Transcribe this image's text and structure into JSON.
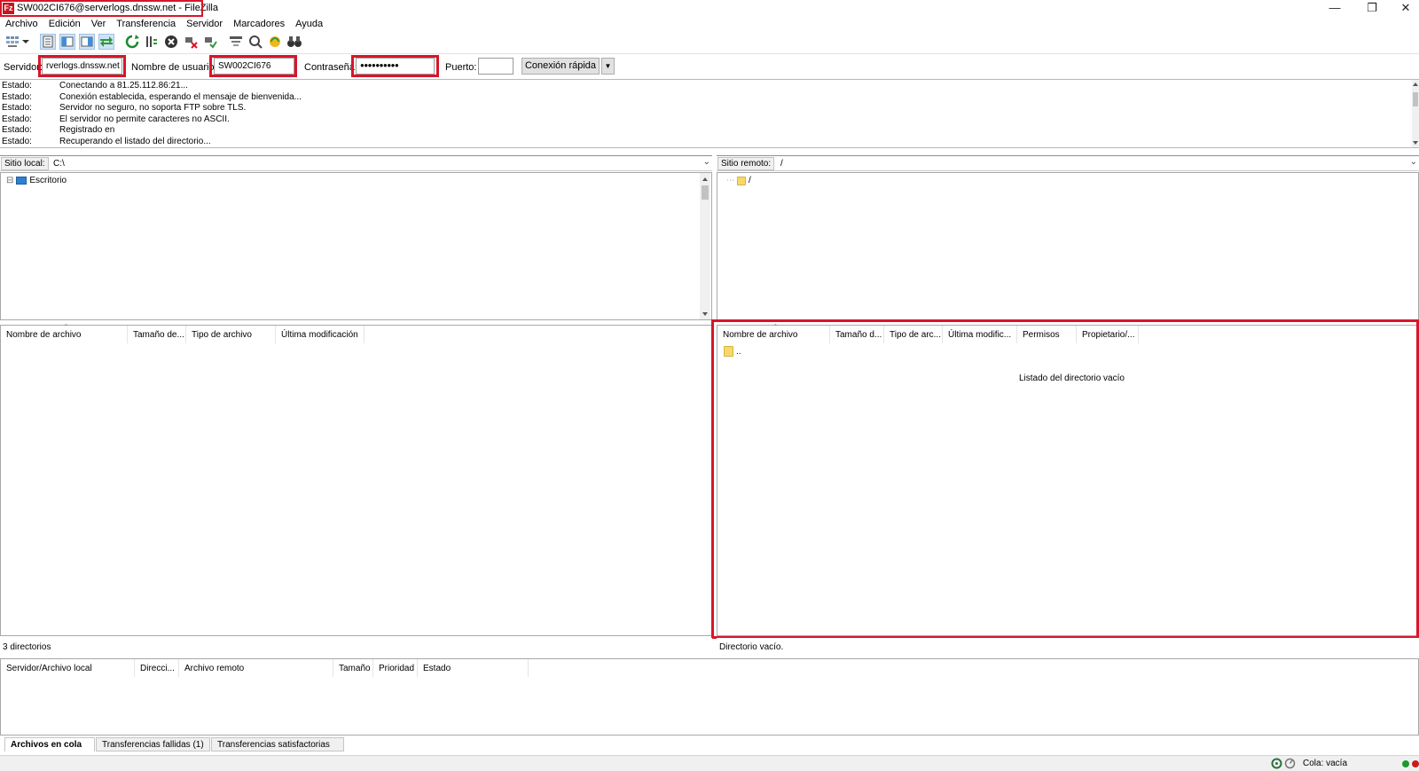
{
  "window": {
    "title": "SW002CI676@serverlogs.dnssw.net - FileZilla",
    "app_icon": "Fz",
    "controls": [
      "—",
      "❐",
      "✕"
    ]
  },
  "menu": [
    "Archivo",
    "Edición",
    "Ver",
    "Transferencia",
    "Servidor",
    "Marcadores",
    "Ayuda"
  ],
  "toolbar": {
    "icons": [
      "site-manager-icon",
      "dropdown-arrow-icon",
      "toggle-log-icon",
      "toggle-local-tree-icon",
      "toggle-remote-tree-icon",
      "toggle-queue-icon",
      "refresh-icon",
      "process-queue-icon",
      "cancel-icon",
      "disconnect-icon",
      "reconnect-icon",
      "filter-icon",
      "search-remote-icon",
      "compare-icon",
      "find-binoculars-icon"
    ]
  },
  "quickconnect": {
    "server_label": "Servidor:",
    "server_value": "rverlogs.dnssw.net",
    "user_label": "Nombre de usuario:",
    "user_value": "SW002CI676",
    "password_label": "Contraseña:",
    "password_value": "●●●●●●●●●●",
    "port_label": "Puerto:",
    "port_value": "",
    "connect_button": "Conexión rápida",
    "dropdown_glyph": "▼"
  },
  "log": [
    {
      "label": "Estado:",
      "message": "Conectando a 81.25.112.86:21..."
    },
    {
      "label": "Estado:",
      "message": "Conexión establecida, esperando el mensaje de bienvenida..."
    },
    {
      "label": "Estado:",
      "message": "Servidor no seguro, no soporta FTP sobre TLS."
    },
    {
      "label": "Estado:",
      "message": "El servidor no permite caracteres no ASCII."
    },
    {
      "label": "Estado:",
      "message": "Registrado en"
    },
    {
      "label": "Estado:",
      "message": "Recuperando el listado del directorio..."
    }
  ],
  "local": {
    "path_label": "Sitio local:",
    "path_value": "C:\\",
    "tree": [
      {
        "expander": "⊟",
        "label": "Escritorio"
      }
    ],
    "columns": [
      "Nombre de archivo",
      "Tamaño de...",
      "Tipo de archivo",
      "Última modificación"
    ],
    "status": "3 directorios"
  },
  "remote": {
    "path_label": "Sitio remoto:",
    "path_value": "/",
    "tree": [
      {
        "label": "/"
      }
    ],
    "columns": [
      "Nombre de archivo",
      "Tamaño d...",
      "Tipo de arc...",
      "Última modific...",
      "Permisos",
      "Propietario/..."
    ],
    "parent_entry": "..",
    "empty_message": "Listado del directorio vacío",
    "status": "Directorio vacío."
  },
  "queue": {
    "columns": [
      "Servidor/Archivo local",
      "Direcci...",
      "Archivo remoto",
      "Tamaño",
      "Prioridad",
      "Estado"
    ],
    "tabs": [
      "Archivos en cola",
      "Transferencias fallidas (1)",
      "Transferencias satisfactorias"
    ],
    "status": "Cola: vacía"
  },
  "colors": {
    "highlight": "#d9142a",
    "accent": "#c8161d"
  }
}
